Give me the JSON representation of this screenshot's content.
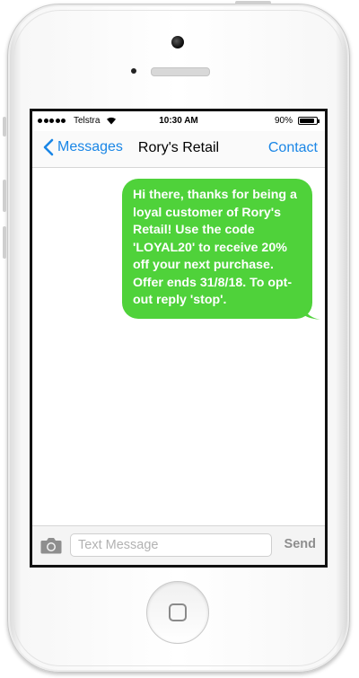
{
  "status_bar": {
    "carrier": "Telstra",
    "time": "10:30 AM",
    "battery_percent": "90%",
    "battery_level": 0.9,
    "signal_bars": 5,
    "wifi_icon": "wifi-icon"
  },
  "nav": {
    "back_label": "Messages",
    "back_icon": "chevron-left-icon",
    "title": "Rory's Retail",
    "action_label": "Contact"
  },
  "messages": [
    {
      "direction": "sent",
      "text": "Hi there, thanks for being a loyal customer of Rory's Retail! Use the code 'LOYAL20' to receive 20% off your next purchase. Offer ends 31/8/18. To opt-out reply 'stop'.",
      "color": "#4fd23a"
    }
  ],
  "composer": {
    "camera_icon": "camera-icon",
    "placeholder": "Text Message",
    "value": "",
    "send_label": "Send"
  },
  "colors": {
    "accent": "#1a86e6",
    "bubble_green": "#4fd23a",
    "send_disabled": "#8e8e8e"
  }
}
